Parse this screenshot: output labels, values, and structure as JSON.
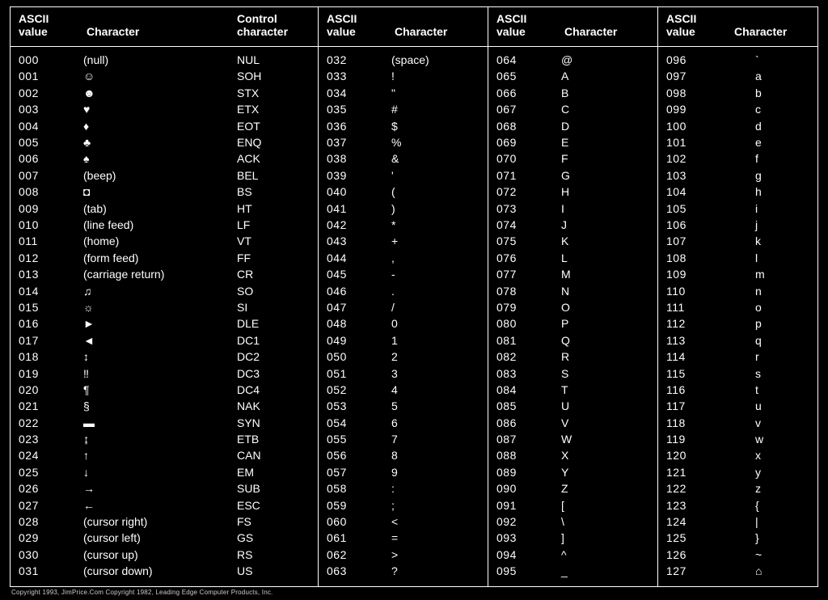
{
  "headers": {
    "col0": {
      "l1a": "ASCII",
      "l2a": "value",
      "l1b": "",
      "l2b": "Character",
      "l1c": "Control",
      "l2c": "character"
    },
    "col1": {
      "l1a": "ASCII",
      "l2a": "value",
      "l1b": "",
      "l2b": "Character"
    },
    "col2": {
      "l1a": "ASCII",
      "l2a": "value",
      "l1b": "",
      "l2b": "Character"
    },
    "col3": {
      "l1a": "ASCII",
      "l2a": "value",
      "l1b": "",
      "l2b": "Character"
    }
  },
  "columns": [
    [
      {
        "value": "000",
        "char": "(null)",
        "ctrl": "NUL"
      },
      {
        "value": "001",
        "char": "☺",
        "ctrl": "SOH"
      },
      {
        "value": "002",
        "char": "☻",
        "ctrl": "STX"
      },
      {
        "value": "003",
        "char": "♥",
        "ctrl": "ETX"
      },
      {
        "value": "004",
        "char": "♦",
        "ctrl": "EOT"
      },
      {
        "value": "005",
        "char": "♣",
        "ctrl": "ENQ"
      },
      {
        "value": "006",
        "char": "♠",
        "ctrl": "ACK"
      },
      {
        "value": "007",
        "char": "(beep)",
        "ctrl": "BEL"
      },
      {
        "value": "008",
        "char": "◘",
        "ctrl": "BS"
      },
      {
        "value": "009",
        "char": "(tab)",
        "ctrl": "HT"
      },
      {
        "value": "010",
        "char": "(line feed)",
        "ctrl": "LF"
      },
      {
        "value": "011",
        "char": "(home)",
        "ctrl": "VT"
      },
      {
        "value": "012",
        "char": "(form feed)",
        "ctrl": "FF"
      },
      {
        "value": "013",
        "char": "(carriage return)",
        "ctrl": "CR"
      },
      {
        "value": "014",
        "char": "♫",
        "ctrl": "SO"
      },
      {
        "value": "015",
        "char": "☼",
        "ctrl": "SI"
      },
      {
        "value": "016",
        "char": "►",
        "ctrl": "DLE"
      },
      {
        "value": "017",
        "char": "◄",
        "ctrl": "DC1"
      },
      {
        "value": "018",
        "char": "↕",
        "ctrl": "DC2"
      },
      {
        "value": "019",
        "char": "‼",
        "ctrl": "DC3"
      },
      {
        "value": "020",
        "char": "¶",
        "ctrl": "DC4"
      },
      {
        "value": "021",
        "char": "§",
        "ctrl": "NAK"
      },
      {
        "value": "022",
        "char": "▬",
        "ctrl": "SYN"
      },
      {
        "value": "023",
        "char": "↨",
        "ctrl": "ETB"
      },
      {
        "value": "024",
        "char": "↑",
        "ctrl": "CAN"
      },
      {
        "value": "025",
        "char": "↓",
        "ctrl": "EM"
      },
      {
        "value": "026",
        "char": "→",
        "ctrl": "SUB"
      },
      {
        "value": "027",
        "char": "←",
        "ctrl": "ESC"
      },
      {
        "value": "028",
        "char": "(cursor right)",
        "ctrl": "FS"
      },
      {
        "value": "029",
        "char": "(cursor left)",
        "ctrl": "GS"
      },
      {
        "value": "030",
        "char": "(cursor up)",
        "ctrl": "RS"
      },
      {
        "value": "031",
        "char": "(cursor down)",
        "ctrl": "US"
      }
    ],
    [
      {
        "value": "032",
        "char": "(space)"
      },
      {
        "value": "033",
        "char": "!"
      },
      {
        "value": "034",
        "char": "\""
      },
      {
        "value": "035",
        "char": "#"
      },
      {
        "value": "036",
        "char": "$"
      },
      {
        "value": "037",
        "char": "%"
      },
      {
        "value": "038",
        "char": "&"
      },
      {
        "value": "039",
        "char": "'"
      },
      {
        "value": "040",
        "char": "("
      },
      {
        "value": "041",
        "char": ")"
      },
      {
        "value": "042",
        "char": "*"
      },
      {
        "value": "043",
        "char": "+"
      },
      {
        "value": "044",
        "char": ","
      },
      {
        "value": "045",
        "char": "-"
      },
      {
        "value": "046",
        "char": "."
      },
      {
        "value": "047",
        "char": "/"
      },
      {
        "value": "048",
        "char": "0"
      },
      {
        "value": "049",
        "char": "1"
      },
      {
        "value": "050",
        "char": "2"
      },
      {
        "value": "051",
        "char": "3"
      },
      {
        "value": "052",
        "char": "4"
      },
      {
        "value": "053",
        "char": "5"
      },
      {
        "value": "054",
        "char": "6"
      },
      {
        "value": "055",
        "char": "7"
      },
      {
        "value": "056",
        "char": "8"
      },
      {
        "value": "057",
        "char": "9"
      },
      {
        "value": "058",
        "char": ":"
      },
      {
        "value": "059",
        "char": ";"
      },
      {
        "value": "060",
        "char": "<"
      },
      {
        "value": "061",
        "char": "="
      },
      {
        "value": "062",
        "char": ">"
      },
      {
        "value": "063",
        "char": "?"
      }
    ],
    [
      {
        "value": "064",
        "char": "@"
      },
      {
        "value": "065",
        "char": "A"
      },
      {
        "value": "066",
        "char": "B"
      },
      {
        "value": "067",
        "char": "C"
      },
      {
        "value": "068",
        "char": "D"
      },
      {
        "value": "069",
        "char": "E"
      },
      {
        "value": "070",
        "char": "F"
      },
      {
        "value": "071",
        "char": "G"
      },
      {
        "value": "072",
        "char": "H"
      },
      {
        "value": "073",
        "char": "I"
      },
      {
        "value": "074",
        "char": "J"
      },
      {
        "value": "075",
        "char": "K"
      },
      {
        "value": "076",
        "char": "L"
      },
      {
        "value": "077",
        "char": "M"
      },
      {
        "value": "078",
        "char": "N"
      },
      {
        "value": "079",
        "char": "O"
      },
      {
        "value": "080",
        "char": "P"
      },
      {
        "value": "081",
        "char": "Q"
      },
      {
        "value": "082",
        "char": "R"
      },
      {
        "value": "083",
        "char": "S"
      },
      {
        "value": "084",
        "char": "T"
      },
      {
        "value": "085",
        "char": "U"
      },
      {
        "value": "086",
        "char": "V"
      },
      {
        "value": "087",
        "char": "W"
      },
      {
        "value": "088",
        "char": "X"
      },
      {
        "value": "089",
        "char": "Y"
      },
      {
        "value": "090",
        "char": "Z"
      },
      {
        "value": "091",
        "char": "["
      },
      {
        "value": "092",
        "char": "\\"
      },
      {
        "value": "093",
        "char": "]"
      },
      {
        "value": "094",
        "char": "^"
      },
      {
        "value": "095",
        "char": "_"
      }
    ],
    [
      {
        "value": "096",
        "char": "`"
      },
      {
        "value": "097",
        "char": "a"
      },
      {
        "value": "098",
        "char": "b"
      },
      {
        "value": "099",
        "char": "c"
      },
      {
        "value": "100",
        "char": "d"
      },
      {
        "value": "101",
        "char": "e"
      },
      {
        "value": "102",
        "char": "f"
      },
      {
        "value": "103",
        "char": "g"
      },
      {
        "value": "104",
        "char": "h"
      },
      {
        "value": "105",
        "char": "i"
      },
      {
        "value": "106",
        "char": "j"
      },
      {
        "value": "107",
        "char": "k"
      },
      {
        "value": "108",
        "char": "l"
      },
      {
        "value": "109",
        "char": "m"
      },
      {
        "value": "110",
        "char": "n"
      },
      {
        "value": "111",
        "char": "o"
      },
      {
        "value": "112",
        "char": "p"
      },
      {
        "value": "113",
        "char": "q"
      },
      {
        "value": "114",
        "char": "r"
      },
      {
        "value": "115",
        "char": "s"
      },
      {
        "value": "116",
        "char": "t"
      },
      {
        "value": "117",
        "char": "u"
      },
      {
        "value": "118",
        "char": "v"
      },
      {
        "value": "119",
        "char": "w"
      },
      {
        "value": "120",
        "char": "x"
      },
      {
        "value": "121",
        "char": "y"
      },
      {
        "value": "122",
        "char": "z"
      },
      {
        "value": "123",
        "char": "{"
      },
      {
        "value": "124",
        "char": "|"
      },
      {
        "value": "125",
        "char": "}"
      },
      {
        "value": "126",
        "char": "~"
      },
      {
        "value": "127",
        "char": "⌂"
      }
    ]
  ],
  "footer": "Copyright 1993, JimPrice.Com   Copyright 1982, Leading Edge Computer Products, Inc."
}
